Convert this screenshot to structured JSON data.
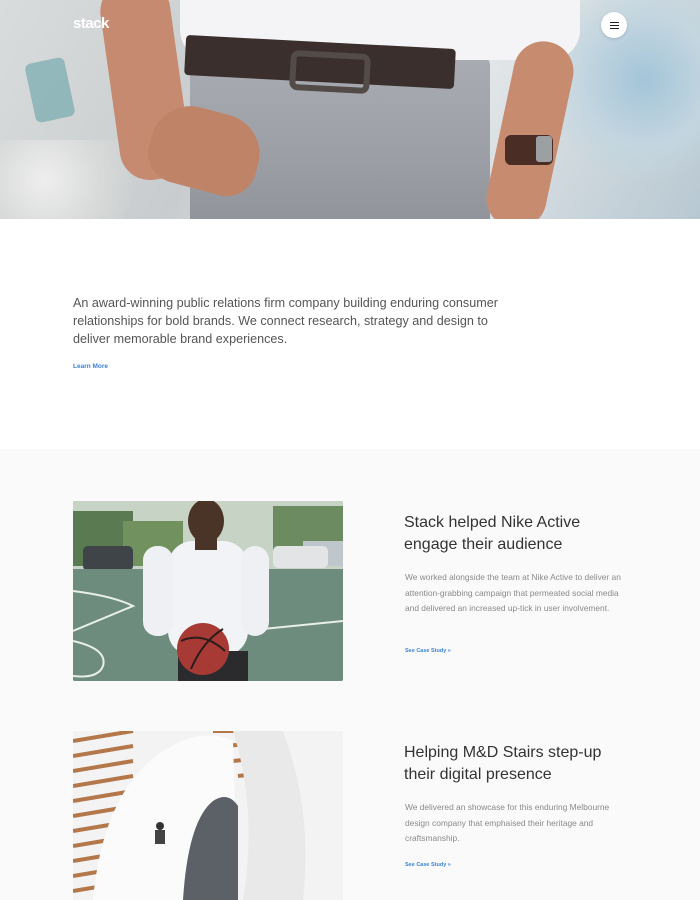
{
  "header": {
    "logo": "stack",
    "menu_icon": "hamburger-icon"
  },
  "intro": {
    "text": "An award-winning public relations firm company building enduring consumer relationships for bold brands. We connect research, strategy and design to deliver memorable brand experiences.",
    "link_label": "Learn More"
  },
  "cases": [
    {
      "title": "Stack helped Nike Active engage their audience",
      "description": "We worked alongside the team at Nike Active to deliver an attention-grabbing campaign that permeated social media and delivered an increased up-tick in user involvement.",
      "link_label": "See Case Study »"
    },
    {
      "title": "Helping M&D Stairs step-up their digital presence",
      "description": "We delivered an showcase for this enduring Melbourne design company that emphaised their heritage and craftsmanship.",
      "link_label": "See Case Study »"
    }
  ],
  "colors": {
    "accent": "#3b82d6",
    "section_bg": "#fafafa"
  }
}
